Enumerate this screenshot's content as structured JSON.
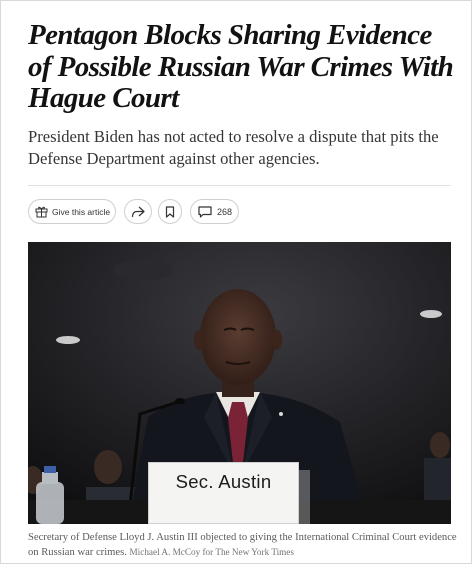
{
  "article": {
    "headline": "Pentagon Blocks Sharing Evidence of Possible Russian War Crimes With Hague Court",
    "summary": "President Biden has not acted to resolve a dispute that pits the Defense Department against other agencies."
  },
  "toolbar": {
    "gift_label": "Give this article",
    "comments_count": "268"
  },
  "photo": {
    "nameplate_text": "Sec. Austin",
    "caption": "Secretary of Defense Lloyd J. Austin III objected to giving the International Criminal Court evidence on Russian war crimes.",
    "credit": "Michael A. McCoy for The New York Times"
  },
  "icons": [
    "gift-icon",
    "share-icon",
    "bookmark-icon",
    "comment-icon"
  ]
}
